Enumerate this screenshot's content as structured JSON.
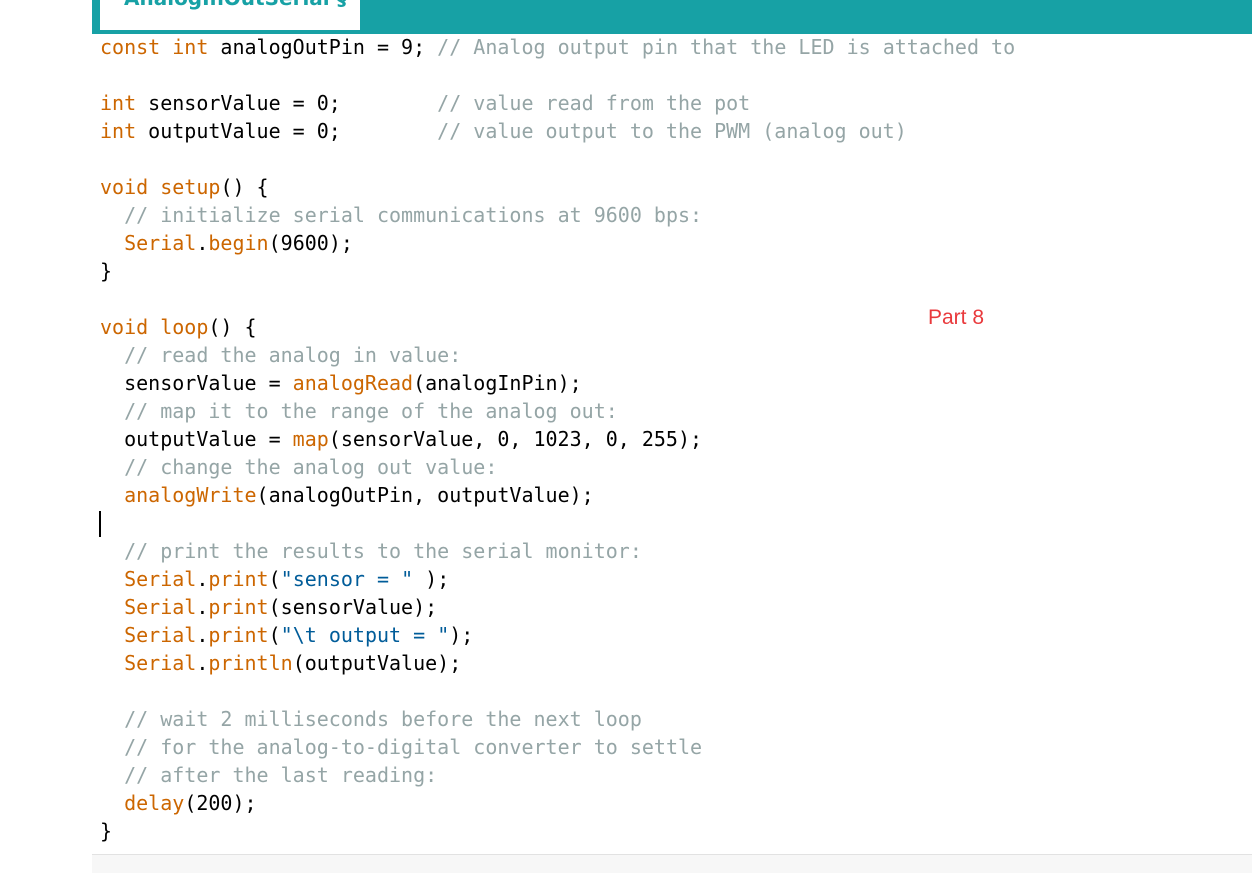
{
  "colors": {
    "tab_bar": "#17a1a5",
    "keyword": "#cc6600",
    "type": "#cc6600",
    "function": "#cc6600",
    "comment": "#95a5a6",
    "string": "#005c99",
    "plain": "#000000",
    "annotation": "#e9393c"
  },
  "tab": {
    "label": "AnalogInOutSerial §"
  },
  "annotation": {
    "text": "Part 8"
  },
  "code_lines": [
    [
      {
        "t": "const",
        "c": "kw"
      },
      {
        "t": " "
      },
      {
        "t": "int",
        "c": "kw"
      },
      {
        "t": " analogOutPin = 9; "
      },
      {
        "t": "// Analog output pin that the LED is attached to",
        "c": "cm"
      }
    ],
    [],
    [
      {
        "t": "int",
        "c": "kw"
      },
      {
        "t": " sensorValue = 0;        "
      },
      {
        "t": "// value read from the pot",
        "c": "cm"
      }
    ],
    [
      {
        "t": "int",
        "c": "kw"
      },
      {
        "t": " outputValue = 0;        "
      },
      {
        "t": "// value output to the PWM (analog out)",
        "c": "cm"
      }
    ],
    [],
    [
      {
        "t": "void",
        "c": "kw"
      },
      {
        "t": " "
      },
      {
        "t": "setup",
        "c": "fn"
      },
      {
        "t": "() {"
      }
    ],
    [
      {
        "t": "  "
      },
      {
        "t": "// initialize serial communications at 9600 bps:",
        "c": "cm"
      }
    ],
    [
      {
        "t": "  "
      },
      {
        "t": "Serial",
        "c": "fn"
      },
      {
        "t": "."
      },
      {
        "t": "begin",
        "c": "fn"
      },
      {
        "t": "(9600);"
      }
    ],
    [
      {
        "t": "}"
      }
    ],
    [],
    [
      {
        "t": "void",
        "c": "kw"
      },
      {
        "t": " "
      },
      {
        "t": "loop",
        "c": "fn"
      },
      {
        "t": "() {"
      }
    ],
    [
      {
        "t": "  "
      },
      {
        "t": "// read the analog in value:",
        "c": "cm"
      }
    ],
    [
      {
        "t": "  sensorValue = "
      },
      {
        "t": "analogRead",
        "c": "fn"
      },
      {
        "t": "(analogInPin);"
      }
    ],
    [
      {
        "t": "  "
      },
      {
        "t": "// map it to the range of the analog out:",
        "c": "cm"
      }
    ],
    [
      {
        "t": "  outputValue = "
      },
      {
        "t": "map",
        "c": "fn"
      },
      {
        "t": "(sensorValue, 0, 1023, 0, 255);"
      }
    ],
    [
      {
        "t": "  "
      },
      {
        "t": "// change the analog out value:",
        "c": "cm"
      }
    ],
    [
      {
        "t": "  "
      },
      {
        "t": "analogWrite",
        "c": "fn"
      },
      {
        "t": "(analogOutPin, outputValue);"
      }
    ],
    [],
    [
      {
        "t": "  "
      },
      {
        "t": "// print the results to the serial monitor:",
        "c": "cm"
      }
    ],
    [
      {
        "t": "  "
      },
      {
        "t": "Serial",
        "c": "fn"
      },
      {
        "t": "."
      },
      {
        "t": "print",
        "c": "fn"
      },
      {
        "t": "("
      },
      {
        "t": "\"sensor = \"",
        "c": "st"
      },
      {
        "t": " );"
      }
    ],
    [
      {
        "t": "  "
      },
      {
        "t": "Serial",
        "c": "fn"
      },
      {
        "t": "."
      },
      {
        "t": "print",
        "c": "fn"
      },
      {
        "t": "(sensorValue);"
      }
    ],
    [
      {
        "t": "  "
      },
      {
        "t": "Serial",
        "c": "fn"
      },
      {
        "t": "."
      },
      {
        "t": "print",
        "c": "fn"
      },
      {
        "t": "("
      },
      {
        "t": "\"\\t output = \"",
        "c": "st"
      },
      {
        "t": ");"
      }
    ],
    [
      {
        "t": "  "
      },
      {
        "t": "Serial",
        "c": "fn"
      },
      {
        "t": "."
      },
      {
        "t": "println",
        "c": "fn"
      },
      {
        "t": "(outputValue);"
      }
    ],
    [],
    [
      {
        "t": "  "
      },
      {
        "t": "// wait 2 milliseconds before the next loop",
        "c": "cm"
      }
    ],
    [
      {
        "t": "  "
      },
      {
        "t": "// for the analog-to-digital converter to settle",
        "c": "cm"
      }
    ],
    [
      {
        "t": "  "
      },
      {
        "t": "// after the last reading:",
        "c": "cm"
      }
    ],
    [
      {
        "t": "  "
      },
      {
        "t": "delay",
        "c": "fn"
      },
      {
        "t": "(200);"
      }
    ],
    [
      {
        "t": "}"
      }
    ]
  ]
}
